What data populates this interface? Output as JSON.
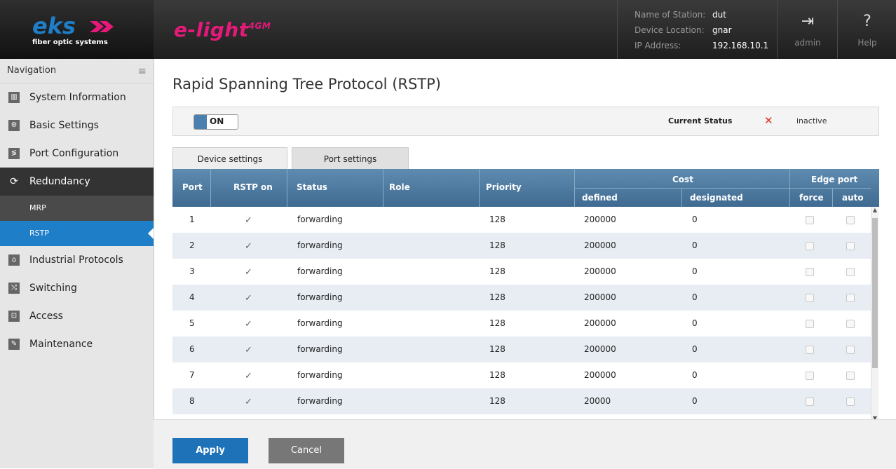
{
  "header": {
    "logo_text": "eks",
    "logo_sub": "fiber optic systems",
    "brand": "e-light",
    "brand_sup": "4GM",
    "station": [
      {
        "key": "Name of Station:",
        "value": "dut"
      },
      {
        "key": "Device Location:",
        "value": "gnar"
      },
      {
        "key": "IP Address:",
        "value": "192.168.10.1"
      }
    ],
    "logout": {
      "label": "admin",
      "icon": "logout-icon"
    },
    "help": {
      "label": "Help",
      "icon": "help-icon"
    }
  },
  "nav": {
    "title": "Navigation",
    "items": [
      {
        "label": "System Information",
        "icon": "chart-icon"
      },
      {
        "label": "Basic Settings",
        "icon": "gear-icon"
      },
      {
        "label": "Port Configuration",
        "icon": "ports-icon"
      },
      {
        "label": "Redundancy",
        "icon": "redundancy-icon"
      },
      {
        "label": "Industrial Protocols",
        "icon": "protocols-icon"
      },
      {
        "label": "Switching",
        "icon": "switching-icon"
      },
      {
        "label": "Access",
        "icon": "lock-icon"
      },
      {
        "label": "Maintenance",
        "icon": "wrench-icon"
      }
    ],
    "subitems": [
      {
        "label": "MRP"
      },
      {
        "label": "RSTP"
      }
    ]
  },
  "main": {
    "title": "Rapid Spanning Tree Protocol (RSTP)",
    "toggle_label": "ON",
    "current_status_label": "Current Status",
    "current_status_value": "inactive",
    "tabs": [
      {
        "label": "Device settings"
      },
      {
        "label": "Port settings"
      }
    ],
    "columns": {
      "port": "Port",
      "rstp_on": "RSTP on",
      "status": "Status",
      "role": "Role",
      "priority": "Priority",
      "cost": "Cost",
      "defined": "defined",
      "designated": "designated",
      "edge_port": "Edge port",
      "force": "force",
      "auto": "auto"
    },
    "rows": [
      {
        "port": "1",
        "status": "forwarding",
        "role": "",
        "priority": "128",
        "defined": "200000",
        "designated": "0"
      },
      {
        "port": "2",
        "status": "forwarding",
        "role": "",
        "priority": "128",
        "defined": "200000",
        "designated": "0"
      },
      {
        "port": "3",
        "status": "forwarding",
        "role": "",
        "priority": "128",
        "defined": "200000",
        "designated": "0"
      },
      {
        "port": "4",
        "status": "forwarding",
        "role": "",
        "priority": "128",
        "defined": "200000",
        "designated": "0"
      },
      {
        "port": "5",
        "status": "forwarding",
        "role": "",
        "priority": "128",
        "defined": "200000",
        "designated": "0"
      },
      {
        "port": "6",
        "status": "forwarding",
        "role": "",
        "priority": "128",
        "defined": "200000",
        "designated": "0"
      },
      {
        "port": "7",
        "status": "forwarding",
        "role": "",
        "priority": "128",
        "defined": "200000",
        "designated": "0"
      },
      {
        "port": "8",
        "status": "forwarding",
        "role": "",
        "priority": "128",
        "defined": "20000",
        "designated": "0"
      }
    ]
  },
  "footer": {
    "apply": "Apply",
    "cancel": "Cancel"
  }
}
